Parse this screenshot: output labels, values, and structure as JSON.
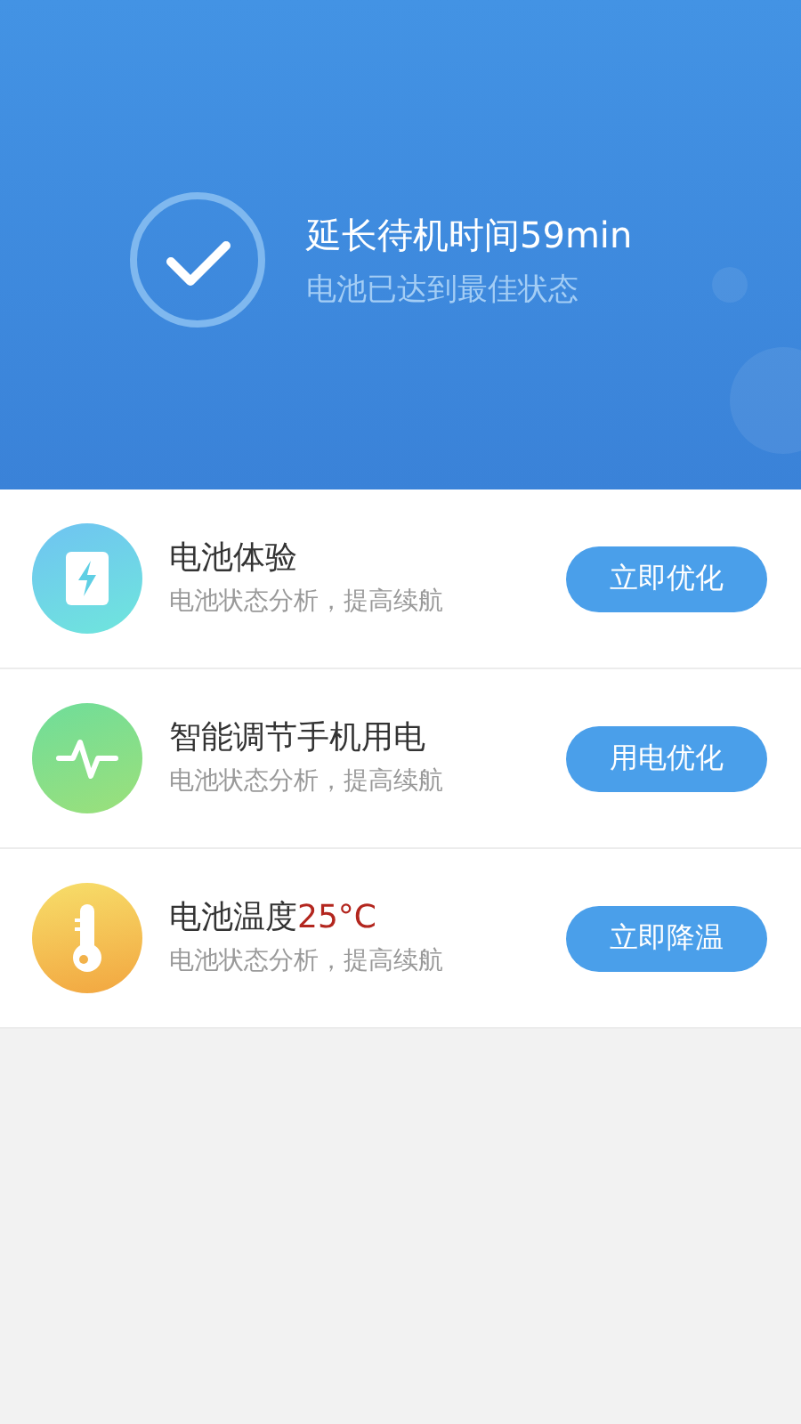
{
  "header": {
    "title": "延长待机时间59min",
    "subtitle": "电池已达到最佳状态"
  },
  "items": [
    {
      "kind": "battery",
      "title": "电池体验",
      "subtitle": "电池状态分析，提高续航",
      "button": "立即优化"
    },
    {
      "kind": "pulse",
      "title": "智能调节手机用电",
      "subtitle": "电池状态分析，提高续航",
      "button": "用电优化"
    },
    {
      "kind": "thermometer",
      "title": "电池温度",
      "value": "25°C",
      "subtitle": "电池状态分析，提高续航",
      "button": "立即降温"
    }
  ]
}
